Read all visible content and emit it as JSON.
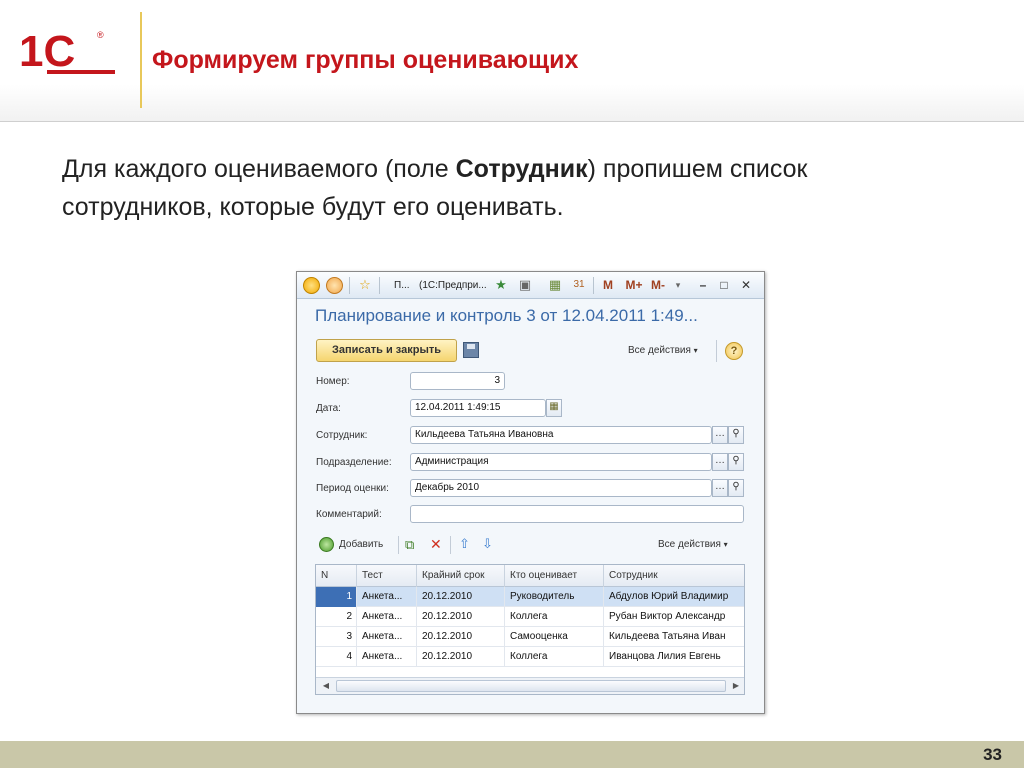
{
  "slide": {
    "logo": "1С",
    "title": "Формируем группы оценивающих",
    "text_before": "Для каждого оцениваемого (поле ",
    "text_bold": "Сотрудник",
    "text_after": ") пропишем список сотрудников, которые будут его оценивать.",
    "page_number": "33"
  },
  "window": {
    "titlebar": {
      "tab_short": "П...",
      "tab_app": "(1С:Предпри...",
      "btn_m": "M",
      "btn_m_plus": "M+",
      "btn_m_minus": "M-",
      "btn_minimize": "–",
      "btn_maximize": "□",
      "btn_close": "✕"
    },
    "form_title": "Планирование и контроль 3 от 12.04.2011 1:49...",
    "toolbar": {
      "save_close": "Записать и закрыть",
      "all_actions": "Все действия",
      "help": "?"
    },
    "fields": {
      "number_label": "Номер:",
      "number_value": "3",
      "date_label": "Дата:",
      "date_value": "12.04.2011  1:49:15",
      "employee_label": "Сотрудник:",
      "employee_value": "Кильдеева Татьяна Ивановна",
      "department_label": "Подразделение:",
      "department_value": "Администрация",
      "period_label": "Период оценки:",
      "period_value": "Декабрь 2010",
      "comment_label": "Комментарий:",
      "comment_value": ""
    },
    "table_toolbar": {
      "add": "Добавить",
      "all_actions": "Все действия"
    },
    "table": {
      "columns": [
        "N",
        "Тест",
        "Крайний срок",
        "Кто оценивает",
        "Сотрудник"
      ],
      "rows": [
        {
          "n": "1",
          "test": "Анкета...",
          "deadline": "20.12.2010",
          "who": "Руководитель",
          "employee": "Абдулов Юрий Владимир"
        },
        {
          "n": "2",
          "test": "Анкета...",
          "deadline": "20.12.2010",
          "who": "Коллега",
          "employee": "Рубан Виктор Александр"
        },
        {
          "n": "3",
          "test": "Анкета...",
          "deadline": "20.12.2010",
          "who": "Самооценка",
          "employee": "Кильдеева Татьяна Иван"
        },
        {
          "n": "4",
          "test": "Анкета...",
          "deadline": "20.12.2010",
          "who": "Коллега",
          "employee": "Иванцова Лилия Евгень"
        }
      ],
      "selected_row": 1
    }
  },
  "colors": {
    "brand_red": "#c4161c",
    "form_title_blue": "#3b6aa8",
    "selection": "#3d6fb5",
    "footer_band": "#c9c7a8"
  }
}
